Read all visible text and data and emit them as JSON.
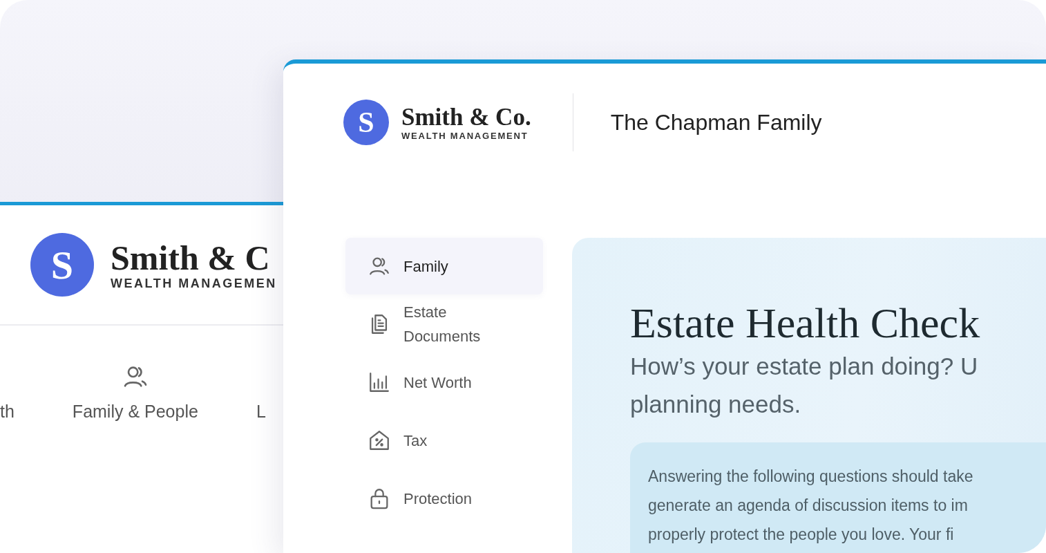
{
  "back_window": {
    "logo": {
      "letter": "S",
      "name": "Smith & C",
      "tagline": "WEALTH MANAGEMEN"
    },
    "nav": [
      {
        "label": "th",
        "kind": "none"
      },
      {
        "label": "Family & People",
        "kind": "people"
      },
      {
        "label": "L",
        "kind": "none"
      }
    ]
  },
  "window": {
    "logo": {
      "letter": "S",
      "name": "Smith & Co.",
      "tagline": "WEALTH MANAGEMENT"
    },
    "client_name": "The Chapman Family",
    "sidebar": {
      "items": [
        {
          "label": "Family",
          "kind": "people",
          "selected": true
        },
        {
          "label": "Estate Documents",
          "kind": "documents",
          "selected": false
        },
        {
          "label": "Net Worth",
          "kind": "chart",
          "selected": false
        },
        {
          "label": "Tax",
          "kind": "tax",
          "selected": false
        },
        {
          "label": "Protection",
          "kind": "lock",
          "selected": false
        }
      ]
    },
    "main": {
      "title": "Estate Health Check",
      "subtitle_lines": [
        "How’s your estate plan doing? U",
        "planning needs."
      ],
      "intro_lines": [
        "Answering the following questions should take",
        "generate an agenda of discussion items to im",
        "properly protect the people you love.  Your fi"
      ]
    }
  }
}
